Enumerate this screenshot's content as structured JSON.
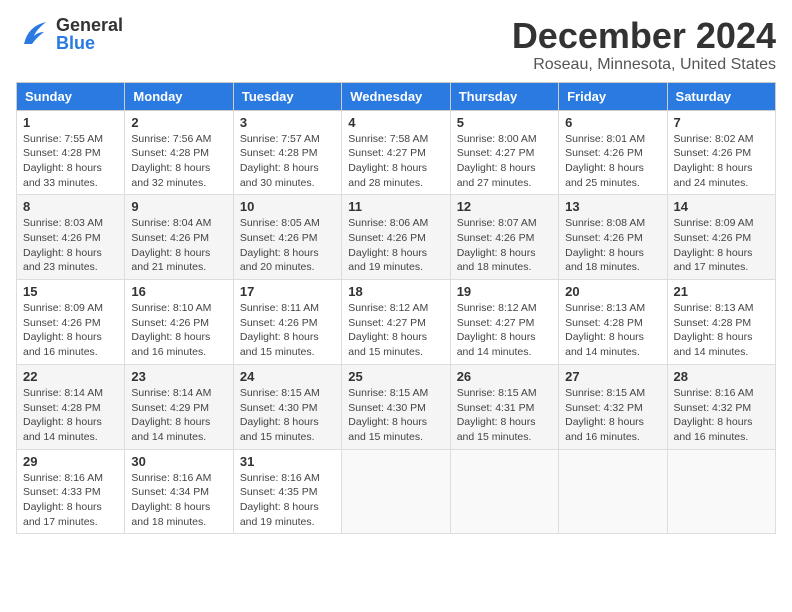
{
  "header": {
    "logo_general": "General",
    "logo_blue": "Blue",
    "title": "December 2024",
    "subtitle": "Roseau, Minnesota, United States"
  },
  "weekdays": [
    "Sunday",
    "Monday",
    "Tuesday",
    "Wednesday",
    "Thursday",
    "Friday",
    "Saturday"
  ],
  "weeks": [
    [
      {
        "day": "1",
        "sunrise": "7:55 AM",
        "sunset": "4:28 PM",
        "daylight": "8 hours and 33 minutes."
      },
      {
        "day": "2",
        "sunrise": "7:56 AM",
        "sunset": "4:28 PM",
        "daylight": "8 hours and 32 minutes."
      },
      {
        "day": "3",
        "sunrise": "7:57 AM",
        "sunset": "4:28 PM",
        "daylight": "8 hours and 30 minutes."
      },
      {
        "day": "4",
        "sunrise": "7:58 AM",
        "sunset": "4:27 PM",
        "daylight": "8 hours and 28 minutes."
      },
      {
        "day": "5",
        "sunrise": "8:00 AM",
        "sunset": "4:27 PM",
        "daylight": "8 hours and 27 minutes."
      },
      {
        "day": "6",
        "sunrise": "8:01 AM",
        "sunset": "4:26 PM",
        "daylight": "8 hours and 25 minutes."
      },
      {
        "day": "7",
        "sunrise": "8:02 AM",
        "sunset": "4:26 PM",
        "daylight": "8 hours and 24 minutes."
      }
    ],
    [
      {
        "day": "8",
        "sunrise": "8:03 AM",
        "sunset": "4:26 PM",
        "daylight": "8 hours and 23 minutes."
      },
      {
        "day": "9",
        "sunrise": "8:04 AM",
        "sunset": "4:26 PM",
        "daylight": "8 hours and 21 minutes."
      },
      {
        "day": "10",
        "sunrise": "8:05 AM",
        "sunset": "4:26 PM",
        "daylight": "8 hours and 20 minutes."
      },
      {
        "day": "11",
        "sunrise": "8:06 AM",
        "sunset": "4:26 PM",
        "daylight": "8 hours and 19 minutes."
      },
      {
        "day": "12",
        "sunrise": "8:07 AM",
        "sunset": "4:26 PM",
        "daylight": "8 hours and 18 minutes."
      },
      {
        "day": "13",
        "sunrise": "8:08 AM",
        "sunset": "4:26 PM",
        "daylight": "8 hours and 18 minutes."
      },
      {
        "day": "14",
        "sunrise": "8:09 AM",
        "sunset": "4:26 PM",
        "daylight": "8 hours and 17 minutes."
      }
    ],
    [
      {
        "day": "15",
        "sunrise": "8:09 AM",
        "sunset": "4:26 PM",
        "daylight": "8 hours and 16 minutes."
      },
      {
        "day": "16",
        "sunrise": "8:10 AM",
        "sunset": "4:26 PM",
        "daylight": "8 hours and 16 minutes."
      },
      {
        "day": "17",
        "sunrise": "8:11 AM",
        "sunset": "4:26 PM",
        "daylight": "8 hours and 15 minutes."
      },
      {
        "day": "18",
        "sunrise": "8:12 AM",
        "sunset": "4:27 PM",
        "daylight": "8 hours and 15 minutes."
      },
      {
        "day": "19",
        "sunrise": "8:12 AM",
        "sunset": "4:27 PM",
        "daylight": "8 hours and 14 minutes."
      },
      {
        "day": "20",
        "sunrise": "8:13 AM",
        "sunset": "4:28 PM",
        "daylight": "8 hours and 14 minutes."
      },
      {
        "day": "21",
        "sunrise": "8:13 AM",
        "sunset": "4:28 PM",
        "daylight": "8 hours and 14 minutes."
      }
    ],
    [
      {
        "day": "22",
        "sunrise": "8:14 AM",
        "sunset": "4:28 PM",
        "daylight": "8 hours and 14 minutes."
      },
      {
        "day": "23",
        "sunrise": "8:14 AM",
        "sunset": "4:29 PM",
        "daylight": "8 hours and 14 minutes."
      },
      {
        "day": "24",
        "sunrise": "8:15 AM",
        "sunset": "4:30 PM",
        "daylight": "8 hours and 15 minutes."
      },
      {
        "day": "25",
        "sunrise": "8:15 AM",
        "sunset": "4:30 PM",
        "daylight": "8 hours and 15 minutes."
      },
      {
        "day": "26",
        "sunrise": "8:15 AM",
        "sunset": "4:31 PM",
        "daylight": "8 hours and 15 minutes."
      },
      {
        "day": "27",
        "sunrise": "8:15 AM",
        "sunset": "4:32 PM",
        "daylight": "8 hours and 16 minutes."
      },
      {
        "day": "28",
        "sunrise": "8:16 AM",
        "sunset": "4:32 PM",
        "daylight": "8 hours and 16 minutes."
      }
    ],
    [
      {
        "day": "29",
        "sunrise": "8:16 AM",
        "sunset": "4:33 PM",
        "daylight": "8 hours and 17 minutes."
      },
      {
        "day": "30",
        "sunrise": "8:16 AM",
        "sunset": "4:34 PM",
        "daylight": "8 hours and 18 minutes."
      },
      {
        "day": "31",
        "sunrise": "8:16 AM",
        "sunset": "4:35 PM",
        "daylight": "8 hours and 19 minutes."
      },
      null,
      null,
      null,
      null
    ]
  ]
}
